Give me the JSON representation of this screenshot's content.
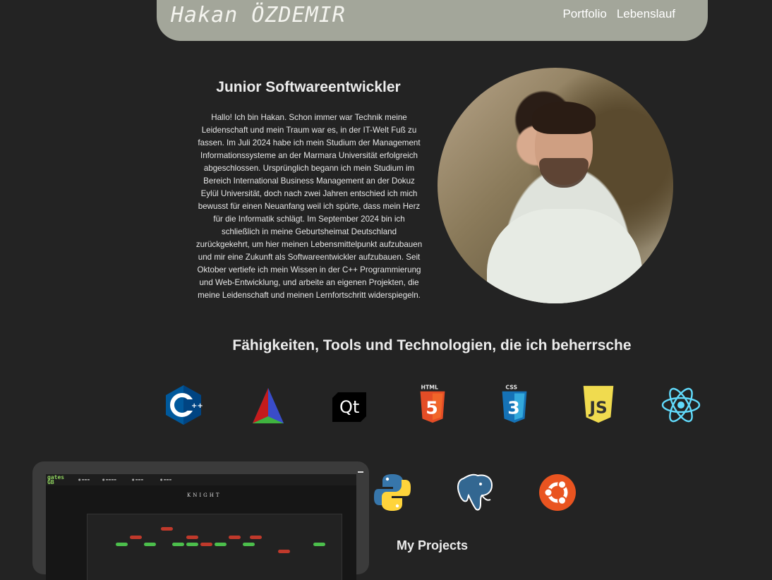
{
  "header": {
    "brand": "Hakan ÖZDEMIR",
    "nav": [
      "Portfolio",
      "Lebenslauf"
    ]
  },
  "intro": {
    "title": "Junior Softwareentwickler",
    "lines": [
      "Hallo! Ich bin Hakan. Schon immer war Technik meine",
      "Leidenschaft und mein Traum war es, in der IT-Welt Fuß zu",
      "fassen. Im Juli 2024 habe ich mein Studium der Management",
      "Informationssysteme an der Marmara Universität erfolgreich",
      "abgeschlossen. Ursprünglich begann ich mein Studium im",
      "Bereich International Business Management an der Dokuz",
      "Eylül Universität, doch nach zwei Jahren entschied ich mich",
      "bewusst für einen Neuanfang weil ich spürte, dass mein Herz",
      "für die Informatik schlägt. Im September 2024 bin ich",
      "schließlich in meine Geburtsheimat Deutschland",
      "zurückgekehrt, um hier meinen Lebensmittelpunkt aufzubauen",
      "und mir eine Zukunft als Softwareentwickler aufzubauen. Seit",
      "Oktober vertiefe ich mein Wissen in der C++ Programmierung",
      "und Web-Entwicklung, und arbeite an eigenen Projekten, die",
      "meine Leidenschaft und meinen Lernfortschritt widerspiegeln."
    ]
  },
  "skills": {
    "title": "Fähigkeiten, Tools und Technologien, die ich beherrsche",
    "icons": [
      "cplusplus-icon",
      "cmake-icon",
      "qt-icon",
      "html5-icon",
      "css3-icon",
      "javascript-icon",
      "react-icon",
      "python-icon",
      "postgresql-icon",
      "ubuntu-icon"
    ],
    "html_label": "HTML",
    "css_label": "CSS",
    "qt_label": "Qt",
    "js_label": "JS"
  },
  "projects": {
    "title": "My Projects",
    "preview": {
      "logo": "gates GB",
      "knight": "KNIGHT"
    }
  },
  "colors": {
    "background": "#232323",
    "header": "#a3a69a"
  }
}
